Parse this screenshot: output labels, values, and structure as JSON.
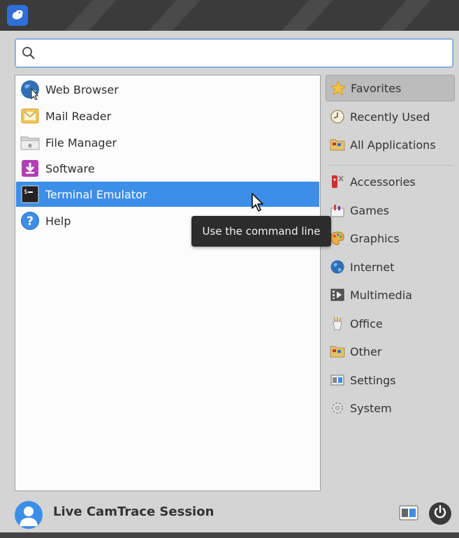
{
  "search": {
    "value": "",
    "placeholder": ""
  },
  "apps": [
    {
      "label": "Web Browser",
      "icon": "web-browser-icon",
      "selected": false
    },
    {
      "label": "Mail Reader",
      "icon": "mail-reader-icon",
      "selected": false
    },
    {
      "label": "File Manager",
      "icon": "file-manager-icon",
      "selected": false
    },
    {
      "label": "Software",
      "icon": "software-icon",
      "selected": false
    },
    {
      "label": "Terminal Emulator",
      "icon": "terminal-icon",
      "selected": true
    },
    {
      "label": "Help",
      "icon": "help-icon",
      "selected": false
    }
  ],
  "tooltip": {
    "text": "Use the command line"
  },
  "categories": [
    {
      "label": "Favorites",
      "icon": "star-icon",
      "active": true
    },
    {
      "label": "Recently Used",
      "icon": "clock-icon",
      "active": false
    },
    {
      "label": "All Applications",
      "icon": "folder-icon",
      "active": false
    },
    {
      "label": "Accessories",
      "icon": "accessories-icon",
      "active": false
    },
    {
      "label": "Games",
      "icon": "games-icon",
      "active": false
    },
    {
      "label": "Graphics",
      "icon": "graphics-icon",
      "active": false
    },
    {
      "label": "Internet",
      "icon": "internet-icon",
      "active": false
    },
    {
      "label": "Multimedia",
      "icon": "multimedia-icon",
      "active": false
    },
    {
      "label": "Office",
      "icon": "office-icon",
      "active": false
    },
    {
      "label": "Other",
      "icon": "other-icon",
      "active": false
    },
    {
      "label": "Settings",
      "icon": "settings-icon",
      "active": false
    },
    {
      "label": "System",
      "icon": "system-icon",
      "active": false
    }
  ],
  "footer": {
    "username": "Live CamTrace Session"
  },
  "colors": {
    "accent": "#3d8ee8",
    "tooltip_bg": "#2c2c2c",
    "panel_bg": "#d4d4d4"
  }
}
